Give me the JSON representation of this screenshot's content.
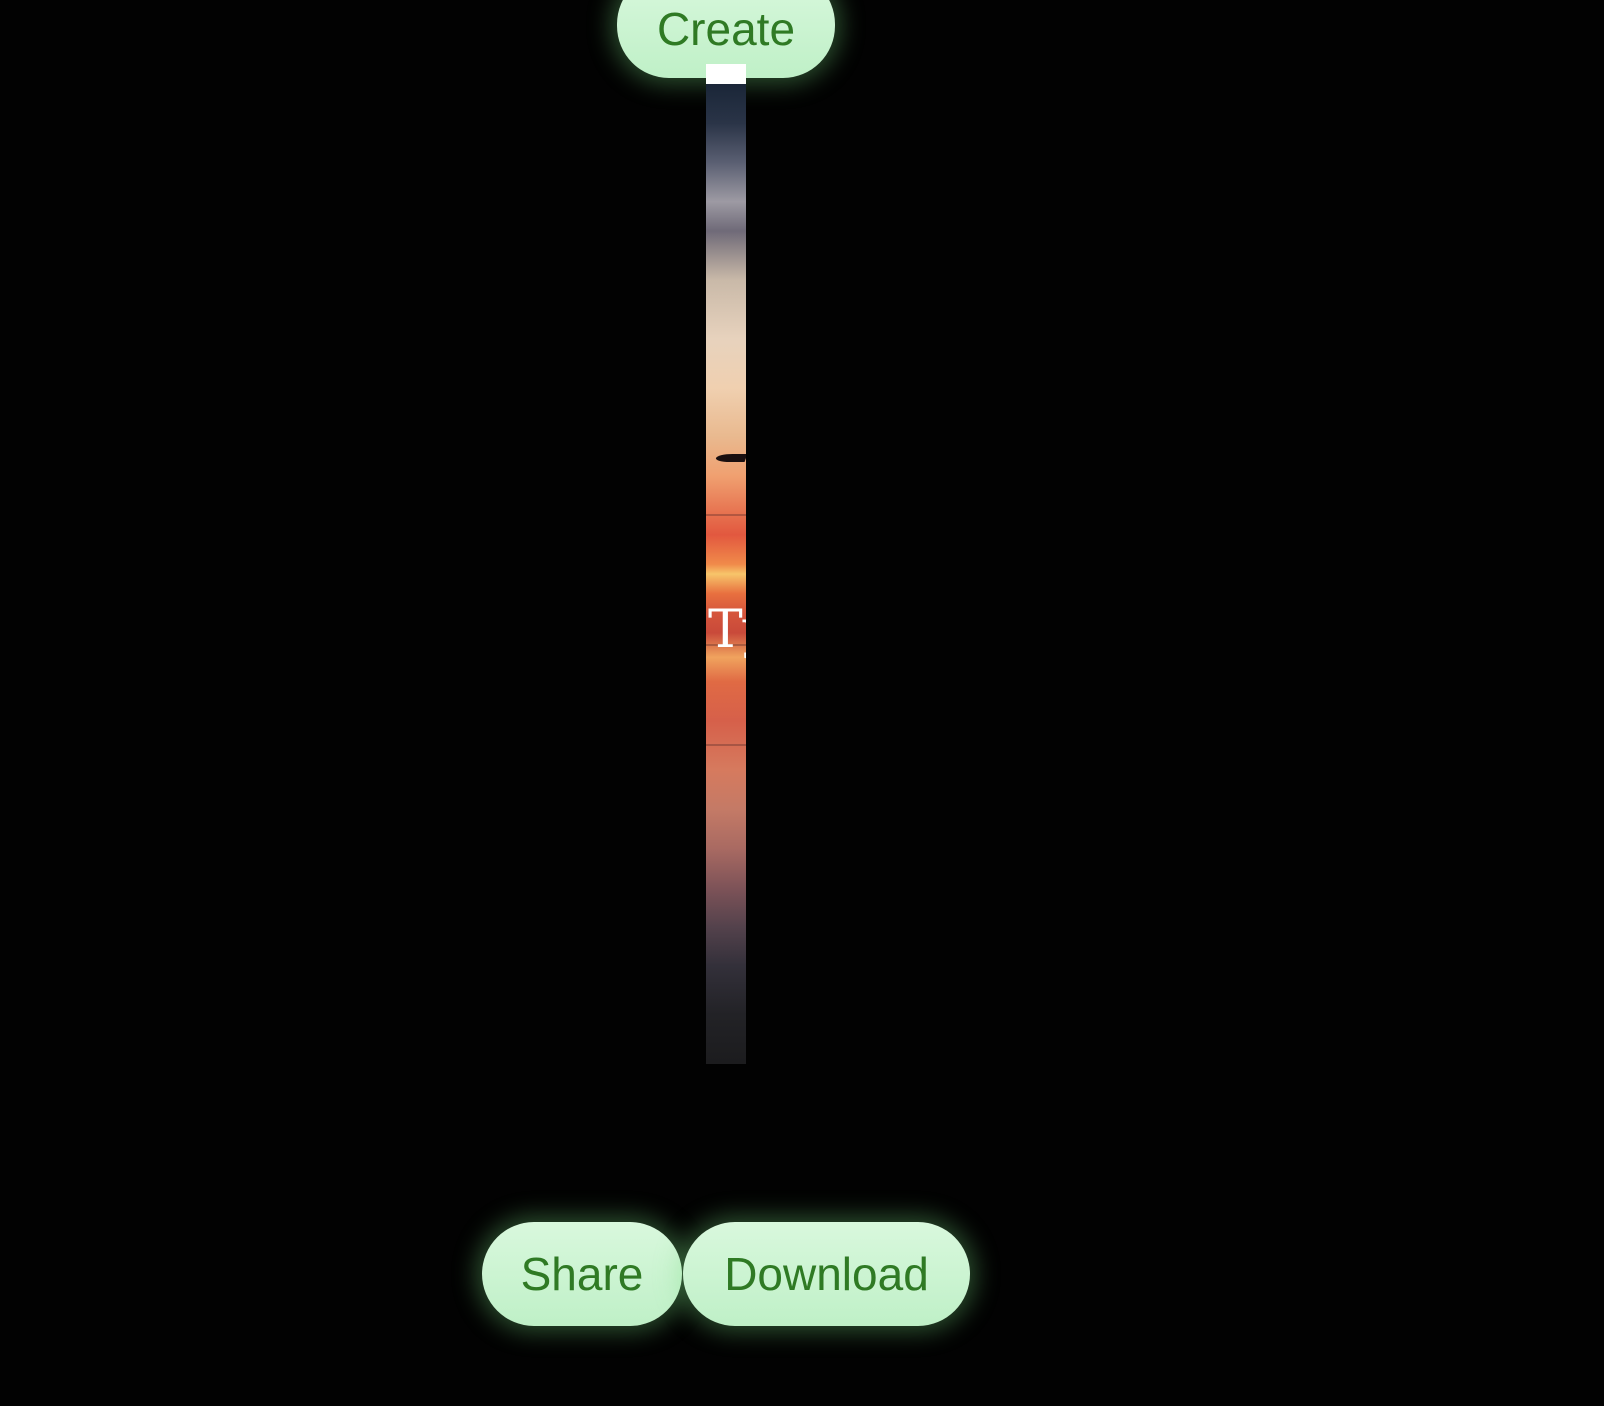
{
  "buttons": {
    "create_label": "Create",
    "share_label": "Share",
    "download_label": "Download"
  },
  "preview": {
    "overlay_text": "Ty"
  },
  "colors": {
    "background": "#020202",
    "button_fill": "#c9f4d0",
    "button_text": "#2f7a24",
    "button_glow": "#78dc82"
  }
}
